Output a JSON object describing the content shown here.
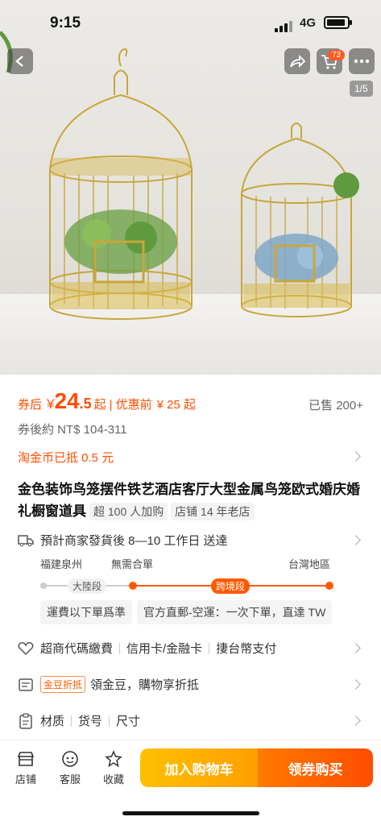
{
  "status": {
    "time": "9:15",
    "network": "4G"
  },
  "header": {
    "cart_count": "73",
    "image_counter": "1/5"
  },
  "price": {
    "label": "券后",
    "currency": "¥",
    "integer": "24",
    "decimal": ".5",
    "qi": "起",
    "original_label": "优惠前",
    "original": "¥ 25 起",
    "sold": "已售 200+",
    "twd": "券後約 NT$ 104-311"
  },
  "coin": {
    "text": "淘金币已抵 0.5 元"
  },
  "product": {
    "title": "金色装饰鸟笼摆件铁艺酒店客厅大型金属鸟笼欧式婚庆婚礼橱窗道具",
    "tag1": "超 100 人加购",
    "tag2": "店铺 14 年老店"
  },
  "shipping": {
    "text": "預計商家發貨後 8—10 工作日 送達",
    "from": "福建泉州",
    "mid": "無需合單",
    "to": "台灣地區",
    "seg1": "大陸段",
    "seg2": "跨境段",
    "chip1": "運費以下單爲準",
    "chip2": "官方直郵-空運：一次下單，直達 TW"
  },
  "payment": {
    "item1": "超商代碼繳費",
    "item2": "信用卡/金融卡",
    "item3": "捿台幣支付"
  },
  "gold": {
    "tag": "金豆折抵",
    "text": "領金豆，購物享折抵"
  },
  "specs": {
    "item1": "材质",
    "item2": "货号",
    "item3": "尺寸"
  },
  "bottom": {
    "store": "店铺",
    "service": "客服",
    "favorite": "收藏",
    "add_cart": "加入购物车",
    "buy": "领券购买"
  },
  "colors": {
    "accent": "#ff4d00",
    "cart_btn": "#ffb000"
  }
}
